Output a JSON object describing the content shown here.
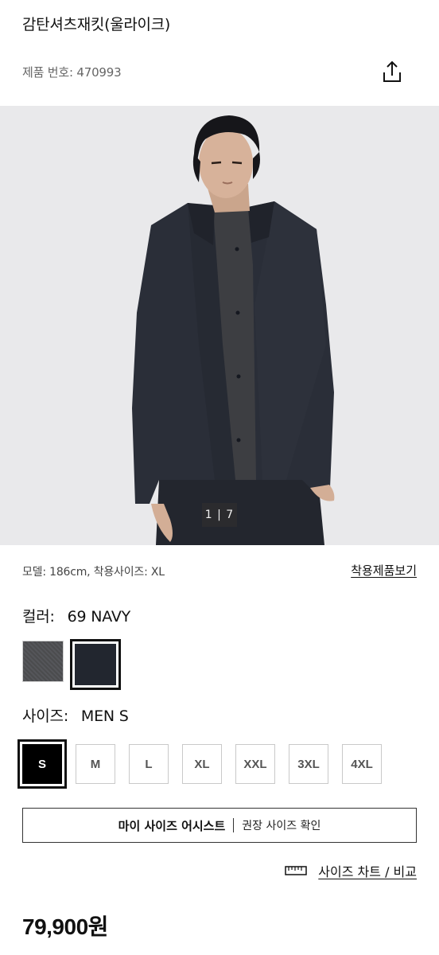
{
  "product": {
    "title": "감탄셔츠재킷(울라이크)",
    "number": "제품 번호: 470993",
    "price": "79,900원"
  },
  "gallery": {
    "counter": "1 | 7"
  },
  "model": {
    "info": "모델: 186cm, 착용사이즈: XL",
    "worn_link": "착용제품보기"
  },
  "color": {
    "label": "컬러:",
    "value": "69 NAVY",
    "swatches": [
      {
        "name": "gray",
        "hex": "#4a4b4d"
      },
      {
        "name": "navy",
        "hex": "#22262f",
        "selected": true
      }
    ]
  },
  "size": {
    "label": "사이즈:",
    "value": "MEN S",
    "options": [
      "S",
      "M",
      "L",
      "XL",
      "XXL",
      "3XL",
      "4XL"
    ],
    "selected": "S"
  },
  "assist": {
    "main": "마이 사이즈 어시스트",
    "sub": "권장 사이즈 확인"
  },
  "size_chart": {
    "label": "사이즈 차트 / 비교"
  },
  "colors": {
    "text": "#111111",
    "muted": "#666666",
    "border": "#c9c9c9",
    "counter_bg": "#2b2b2e"
  }
}
